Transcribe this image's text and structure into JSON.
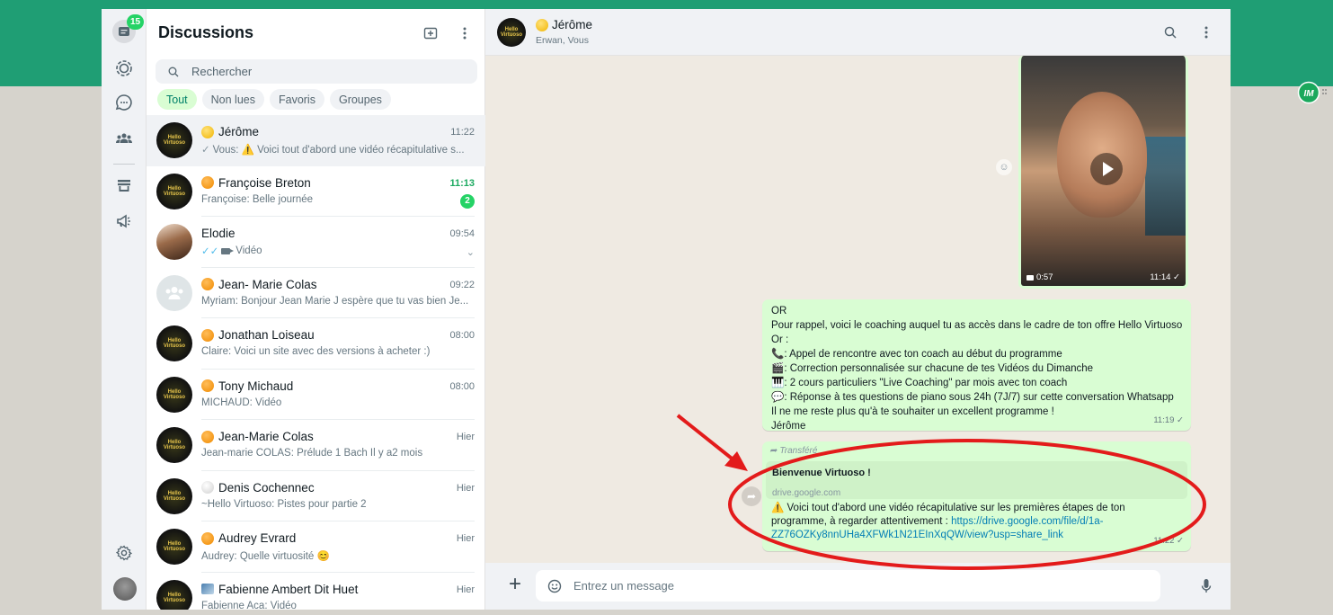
{
  "rail": {
    "chats_badge": "15"
  },
  "list": {
    "title": "Discussions",
    "search_placeholder": "Rechercher",
    "filters": [
      "Tout",
      "Non lues",
      "Favoris",
      "Groupes"
    ],
    "chats": [
      {
        "name": "Jérôme",
        "time": "11:22",
        "preview": "Vous: ⚠️ Voici tout d'abord une vidéo récapitulative s...",
        "status_dot": "yellow",
        "avatar": "hello-virtuoso"
      },
      {
        "name": "Françoise Breton",
        "time": "11:13",
        "preview": "Françoise: Belle journée",
        "unread": "2",
        "status_dot": "orange",
        "avatar": "hello-virtuoso"
      },
      {
        "name": "Elodie",
        "time": "09:54",
        "preview": "Vidéo",
        "status_dot": "none",
        "avatar": "photo"
      },
      {
        "name": "Jean- Marie Colas",
        "time": "09:22",
        "preview": "Myriam: Bonjour Jean Marie  J espère que tu vas bien  Je...",
        "status_dot": "orange",
        "avatar": "group"
      },
      {
        "name": "Jonathan Loiseau",
        "time": "08:00",
        "preview": "Claire: Voici un site avec des versions à acheter :)",
        "status_dot": "orange",
        "avatar": "hello-virtuoso"
      },
      {
        "name": "Tony Michaud",
        "time": "08:00",
        "preview": "MICHAUD: Vidéo",
        "status_dot": "orange",
        "avatar": "hello-virtuoso"
      },
      {
        "name": "Jean-Marie Colas",
        "time": "Hier",
        "preview": "Jean-marie COLAS: Prélude 1 Bach Il y a2 mois",
        "status_dot": "orange",
        "avatar": "hello-virtuoso"
      },
      {
        "name": "Denis Cochennec",
        "time": "Hier",
        "preview": "~Hello Virtuoso: Pistes pour partie 2",
        "status_dot": "white",
        "avatar": "hello-virtuoso"
      },
      {
        "name": "Audrey Evrard",
        "time": "Hier",
        "preview": "Audrey: Quelle virtuosité 😊",
        "status_dot": "orange",
        "avatar": "hello-virtuoso"
      },
      {
        "name": "Fabienne Ambert Dit Huet",
        "time": "Hier",
        "preview": "Fabienne Aca: Vidéo",
        "status_dot": "flag",
        "avatar": "hello-virtuoso"
      }
    ]
  },
  "conversation": {
    "title": "Jérôme",
    "subtitle": "Erwan, Vous",
    "video": {
      "duration": "0:57",
      "time": "11:14 ✓"
    },
    "message1": {
      "lines": [
        "OR",
        "Pour rappel, voici le coaching auquel tu as accès dans le cadre de ton offre Hello Virtuoso",
        "Or :",
        "📞: Appel de rencontre avec ton coach au début du programme",
        "🎬: Correction personnalisée sur chacune de tes Vidéos du Dimanche",
        "🎹: 2 cours particuliers \"Live Coaching\" par mois avec ton coach",
        "💬: Réponse à tes questions de piano sous 24h (7J/7) sur cette conversation Whatsapp",
        "Il ne me reste plus qu'à te souhaiter un excellent programme !",
        "Jérôme"
      ],
      "time": "11:19 ✓"
    },
    "message2": {
      "forwarded": "Transféré",
      "link_title": "Bienvenue Virtuoso !",
      "link_domain": "drive.google.com",
      "text": "⚠️ Voici tout d'abord une vidéo récapitulative sur les premières étapes de ton programme, à regarder attentivement : ",
      "url": "https://drive.google.com/file/d/1a-ZZ76OZKy8nnUHa4XFWk1N21EInXqQW/view?usp=share_link",
      "time": "11:22 ✓"
    },
    "composer_placeholder": "Entrez un message"
  },
  "avatar_text": "Hello Virtuoso",
  "colors": {
    "brand_green": "#1f9e74",
    "bubble": "#d9fdd3",
    "annotation_red": "#e31b1b",
    "unread_green": "#25d366"
  }
}
